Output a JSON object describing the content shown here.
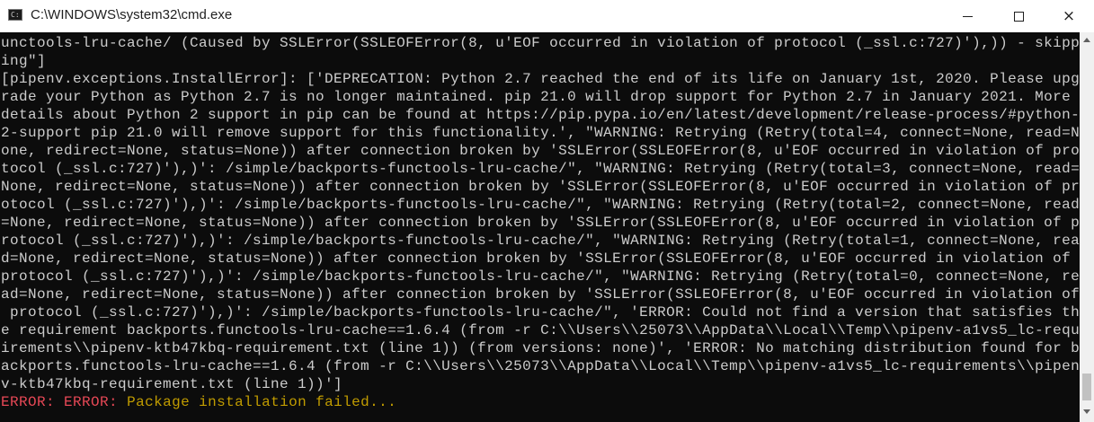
{
  "window": {
    "title": "C:\\WINDOWS\\system32\\cmd.exe",
    "icon": "cmd-icon",
    "controls": {
      "minimize": "minimize-icon",
      "maximize": "maximize-icon",
      "close": "×"
    }
  },
  "console": {
    "lines": [
      "unctools-lru-cache/ (Caused by SSLError(SSLEOFError(8, u'EOF occurred in violation of protocol (_ssl.c:727)'),)) - skipp",
      "ing\"]",
      "[pipenv.exceptions.InstallError]: ['DEPRECATION: Python 2.7 reached the end of its life on January 1st, 2020. Please upg",
      "rade your Python as Python 2.7 is no longer maintained. pip 21.0 will drop support for Python 2.7 in January 2021. More",
      "details about Python 2 support in pip can be found at https://pip.pypa.io/en/latest/development/release-process/#python-",
      "2-support pip 21.0 will remove support for this functionality.', \"WARNING: Retrying (Retry(total=4, connect=None, read=N",
      "one, redirect=None, status=None)) after connection broken by 'SSLError(SSLEOFError(8, u'EOF occurred in violation of pro",
      "tocol (_ssl.c:727)'),)': /simple/backports-functools-lru-cache/\", \"WARNING: Retrying (Retry(total=3, connect=None, read=",
      "None, redirect=None, status=None)) after connection broken by 'SSLError(SSLEOFError(8, u'EOF occurred in violation of pr",
      "otocol (_ssl.c:727)'),)': /simple/backports-functools-lru-cache/\", \"WARNING: Retrying (Retry(total=2, connect=None, read",
      "=None, redirect=None, status=None)) after connection broken by 'SSLError(SSLEOFError(8, u'EOF occurred in violation of p",
      "rotocol (_ssl.c:727)'),)': /simple/backports-functools-lru-cache/\", \"WARNING: Retrying (Retry(total=1, connect=None, rea",
      "d=None, redirect=None, status=None)) after connection broken by 'SSLError(SSLEOFError(8, u'EOF occurred in violation of",
      "protocol (_ssl.c:727)'),)': /simple/backports-functools-lru-cache/\", \"WARNING: Retrying (Retry(total=0, connect=None, re",
      "ad=None, redirect=None, status=None)) after connection broken by 'SSLError(SSLEOFError(8, u'EOF occurred in violation of",
      " protocol (_ssl.c:727)'),)': /simple/backports-functools-lru-cache/\", 'ERROR: Could not find a version that satisfies th",
      "e requirement backports.functools-lru-cache==1.6.4 (from -r C:\\\\Users\\\\25073\\\\AppData\\\\Local\\\\Temp\\\\pipenv-a1vs5_lc-requ",
      "irements\\\\pipenv-ktb47kbq-requirement.txt (line 1)) (from versions: none)', 'ERROR: No matching distribution found for b",
      "ackports.functools-lru-cache==1.6.4 (from -r C:\\\\Users\\\\25073\\\\AppData\\\\Local\\\\Temp\\\\pipenv-a1vs5_lc-requirements\\\\pipen",
      "v-ktb47kbq-requirement.txt (line 1))']"
    ],
    "final_line": {
      "part1": "ERROR",
      "sep1": ": ",
      "part2": "ERROR",
      "sep2": ": ",
      "message": "Package installation failed..."
    },
    "colors": {
      "background": "#0c0c0c",
      "text": "#cccccc",
      "error_red": "#e74856",
      "error_gold": "#c19c00"
    }
  }
}
